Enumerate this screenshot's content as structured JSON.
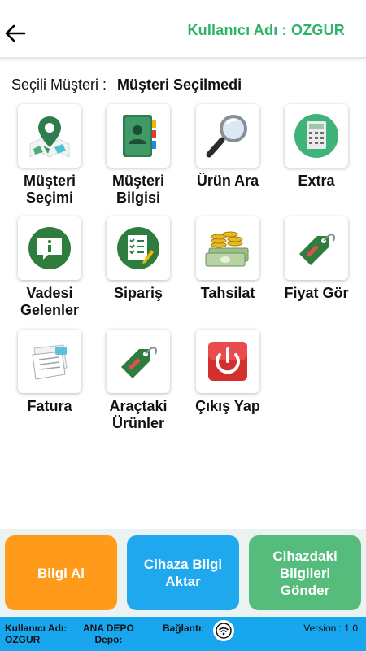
{
  "header": {
    "user_title": "Kullanıcı Adı : OZGUR"
  },
  "selected_customer": {
    "label": "Seçili Müşteri :",
    "value": "Müşteri Seçilmedi"
  },
  "menu": [
    {
      "label": "Müşteri\nSeçimi",
      "icon": "map-pin-icon"
    },
    {
      "label": "Müşteri\nBilgisi",
      "icon": "contact-book-icon"
    },
    {
      "label": "Ürün Ara",
      "icon": "magnifier-icon"
    },
    {
      "label": "Extra",
      "icon": "calculator-icon"
    },
    {
      "label": "Vadesi\nGelenler",
      "icon": "info-bubble-icon"
    },
    {
      "label": "Sipariş",
      "icon": "order-list-icon"
    },
    {
      "label": "Tahsilat",
      "icon": "money-icon"
    },
    {
      "label": "Fiyat Gör",
      "icon": "price-tag-icon"
    },
    {
      "label": "Fatura",
      "icon": "invoice-icon"
    },
    {
      "label": "Araçtaki\nÜrünler",
      "icon": "price-tag-icon"
    },
    {
      "label": "Çıkış Yap",
      "icon": "power-icon"
    }
  ],
  "buttons": {
    "bilgi_al": "Bilgi Al",
    "cihaza_aktar": "Cihaza Bilgi\nAktar",
    "cihazdaki_gonder": "Cihazdaki\nBilgileri\nGönder"
  },
  "status_bar": {
    "user_label": "Kullanıcı Adı:",
    "user_value": "OZGUR",
    "depo_value": "ANA DEPO",
    "depo_label": "Depo:",
    "connection_label": "Bağlantı:",
    "version": "Version : 1.0"
  },
  "colors": {
    "accent_green": "#2fb36a",
    "orange": "#ff9a1a",
    "blue": "#20a8ef",
    "green": "#55bc7c",
    "status_blue": "#18a7ee"
  }
}
